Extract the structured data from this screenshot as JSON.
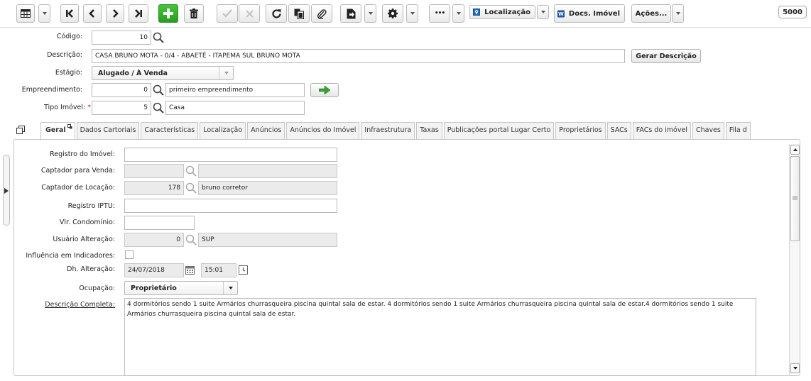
{
  "toolbar": {
    "localizacao_label": "Localização",
    "docs_label": "Docs. Imóvel",
    "acoes_label": "Ações...",
    "counter": "5000",
    "more_label": "•••"
  },
  "header": {
    "codigo_label": "Código:",
    "codigo_value": "10",
    "descricao_label": "Descrição:",
    "descricao_value": "CASA BRUNO MOTA - 0/4 - ABAETÉ - ITAPEMA SUL  BRUNO MOTA",
    "gerar_descricao_label": "Gerar Descrição",
    "estagio_label": "Estágio:",
    "estagio_value": "Alugado / À Venda",
    "empreendimento_label": "Empreendimento:",
    "empreendimento_code": "0",
    "empreendimento_name": "primeiro empreendimento",
    "tipo_imovel_label": "Tipo Imóvel:",
    "required_mark": "*",
    "tipo_imovel_code": "5",
    "tipo_imovel_name": "Casa"
  },
  "tabs": [
    "Geral",
    "Dados Cartoriais",
    "Características",
    "Localização",
    "Anúncios",
    "Anúncios do Imóvel",
    "Infraestrutura",
    "Taxas",
    "Publicações portal Lugar Certo",
    "Proprietários",
    "SACs",
    "FACs do imóvel",
    "Chaves",
    "Fila d"
  ],
  "form": {
    "registro_imovel_label": "Registro do Imóvel:",
    "registro_imovel_value": "",
    "captador_venda_label": "Captador para Venda:",
    "captador_venda_code": "",
    "captador_venda_name": "",
    "captador_locacao_label": "Captador de Locação:",
    "captador_locacao_code": "178",
    "captador_locacao_name": "bruno corretor",
    "registro_iptu_label": "Registro IPTU:",
    "registro_iptu_value": "",
    "vlr_condominio_label": "Vlr. Condomínio:",
    "vlr_condominio_value": "",
    "usuario_alteracao_label": "Usuário Alteração:",
    "usuario_alteracao_code": "0",
    "usuario_alteracao_name": "SUP",
    "influencia_label": "Influência em Indicadores:",
    "dh_alteracao_label": "Dh. Alteração:",
    "dh_alteracao_date": "24/07/2018",
    "dh_alteracao_time": "15:01",
    "ocupacao_label": "Ocupação:",
    "ocupacao_value": "Proprietário",
    "descricao_completa_label": "Descrição Completa:",
    "descricao_completa_value": "4 dormitórios sendo 1 suite Armários  churrasqueira piscina quintal sala de estar. 4 dormitórios sendo 1 suite Armários  churrasqueira piscina quintal sala de estar.4 dormitórios sendo 1 suite Armários  churrasqueira piscina quintal sala de estar."
  },
  "colors": {
    "accent_green": "#2a9d22",
    "border": "#c6c6c6",
    "readonly_bg": "#ebebeb"
  }
}
